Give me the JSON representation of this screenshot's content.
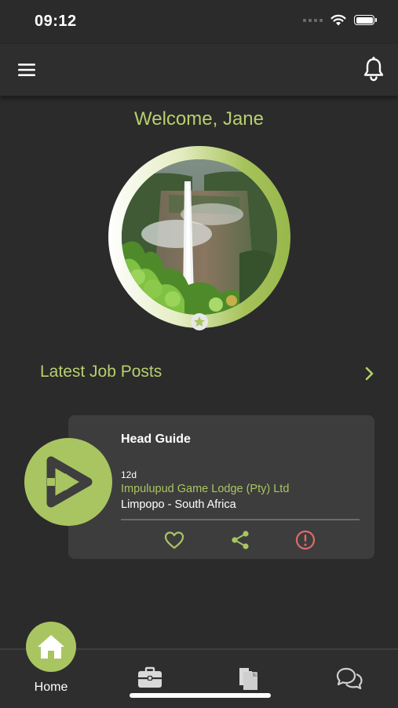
{
  "status_bar": {
    "time": "09:12"
  },
  "header": {
    "menu_icon": "hamburger-menu-icon",
    "notification_icon": "bell-icon"
  },
  "profile": {
    "welcome_text": "Welcome, Jane",
    "photo": "waterfall-profile-photo",
    "badge_icon": "star-icon"
  },
  "latest_jobs": {
    "section_title": "Latest Job Posts",
    "more_icon": "chevron-right-icon",
    "items": [
      {
        "title": "Head Guide",
        "posted": "12d",
        "company": "Impulupud Game Lodge (Pty) Ltd",
        "location": "Limpopo - South Africa",
        "actions": [
          "heart-icon",
          "share-icon",
          "report-icon"
        ]
      }
    ]
  },
  "bottom_nav": {
    "items": [
      {
        "label": "Home",
        "icon": "home-icon",
        "active": true
      },
      {
        "label": "",
        "icon": "briefcase-icon"
      },
      {
        "label": "",
        "icon": "documents-icon"
      },
      {
        "label": "",
        "icon": "chat-icon"
      }
    ]
  },
  "colors": {
    "background": "#2b2b2b",
    "accent": "#a9c561",
    "accent_text": "#b7cf6e",
    "card": "#3d3d3d",
    "report": "#e06a6a"
  }
}
